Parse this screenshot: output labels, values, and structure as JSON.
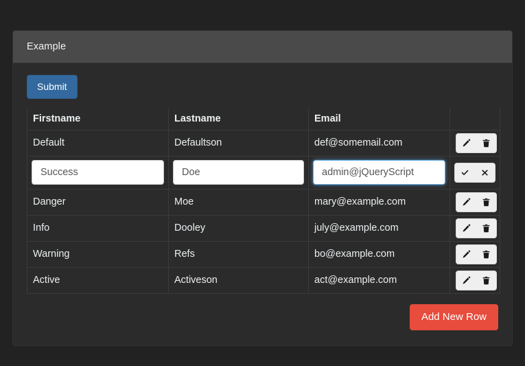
{
  "panel": {
    "title": "Example"
  },
  "toolbar": {
    "submit_label": "Submit"
  },
  "table": {
    "headers": [
      "Firstname",
      "Lastname",
      "Email",
      ""
    ],
    "rows": [
      {
        "mode": "view",
        "firstname": "Default",
        "lastname": "Defaultson",
        "email": "def@somemail.com",
        "actions": [
          "edit-icon",
          "delete-icon"
        ]
      },
      {
        "mode": "edit",
        "firstname": "Success",
        "lastname": "Doe",
        "email": "admin@jQueryScript",
        "actions": [
          "confirm-icon",
          "cancel-icon"
        ]
      },
      {
        "mode": "view",
        "firstname": "Danger",
        "lastname": "Moe",
        "email": "mary@example.com",
        "actions": [
          "edit-icon",
          "delete-icon"
        ]
      },
      {
        "mode": "view",
        "firstname": "Info",
        "lastname": "Dooley",
        "email": "july@example.com",
        "actions": [
          "edit-icon",
          "delete-icon"
        ]
      },
      {
        "mode": "view",
        "firstname": "Warning",
        "lastname": "Refs",
        "email": "bo@example.com",
        "actions": [
          "edit-icon",
          "delete-icon"
        ]
      },
      {
        "mode": "view",
        "firstname": "Active",
        "lastname": "Activeson",
        "email": "act@example.com",
        "actions": [
          "edit-icon",
          "delete-icon"
        ]
      }
    ]
  },
  "footer": {
    "add_label": "Add New Row"
  },
  "colors": {
    "page_background": "#222222",
    "panel_background": "#2b2b2b",
    "panel_header": "#4a4a4a",
    "submit_blue": "#33699e",
    "add_red": "#e74c3c",
    "text": "#eceff1",
    "border": "#3b3b3b",
    "focus_ring": "#66afe9"
  }
}
